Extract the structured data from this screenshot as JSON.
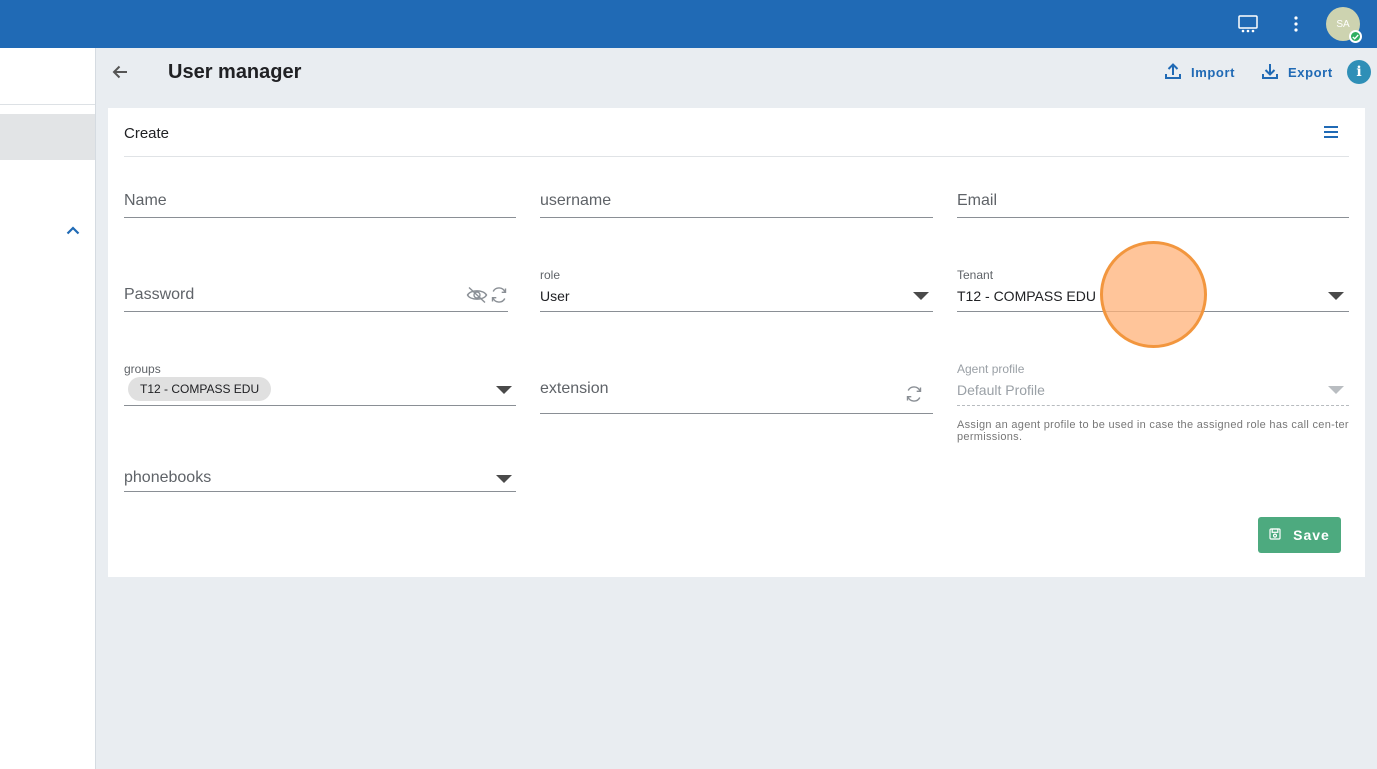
{
  "topbar": {
    "icons": [
      "presentation-icon",
      "more-vertical-icon"
    ],
    "user_initials": "SA",
    "status_color": "#2fae60",
    "bar_color": "#206ab5"
  },
  "header": {
    "title": "User manager",
    "import_label": "Import",
    "export_label": "Export",
    "info_glyph": "i"
  },
  "card": {
    "title": "Create",
    "fields": {
      "name": {
        "placeholder": "Name"
      },
      "username": {
        "placeholder": "username"
      },
      "email": {
        "placeholder": "Email"
      },
      "password": {
        "placeholder": "Password"
      },
      "role": {
        "label": "role",
        "value": "User"
      },
      "tenant": {
        "label": "Tenant",
        "value": "T12 - COMPASS EDU"
      },
      "groups": {
        "label": "groups",
        "chips": [
          "T12 - COMPASS EDU"
        ]
      },
      "extension": {
        "placeholder": "extension"
      },
      "agent_profile": {
        "label": "Agent profile",
        "value": "Default Profile",
        "helper": "Assign an agent profile to be used in case the assigned role has call cen-ter permissions."
      },
      "phonebooks": {
        "placeholder": "phonebooks"
      }
    },
    "save_label": "Save",
    "save_color": "#4daa7f"
  }
}
